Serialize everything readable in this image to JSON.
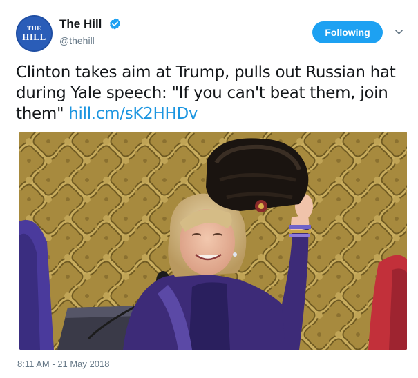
{
  "author": {
    "display_name": "The Hill",
    "handle": "@thehill",
    "avatar_text_top": "THE",
    "avatar_text_bottom": "HILL",
    "verified": true
  },
  "follow_button": {
    "label": "Following"
  },
  "tweet": {
    "text": "Clinton takes aim at Trump, pulls out Russian hat during Yale speech: \"If you can't beat them, join them\" ",
    "link": "hill.cm/sK2HHDv"
  },
  "media": {
    "description_kind": "photo"
  },
  "timestamp": "8:11 AM - 21 May 2018",
  "colors": {
    "accent": "#1da1f2",
    "link": "#1b95e0",
    "secondary_text": "#657786",
    "avatar_bg": "#2a5db8"
  },
  "icons": [
    "verified-badge-icon",
    "caret-down-icon"
  ]
}
